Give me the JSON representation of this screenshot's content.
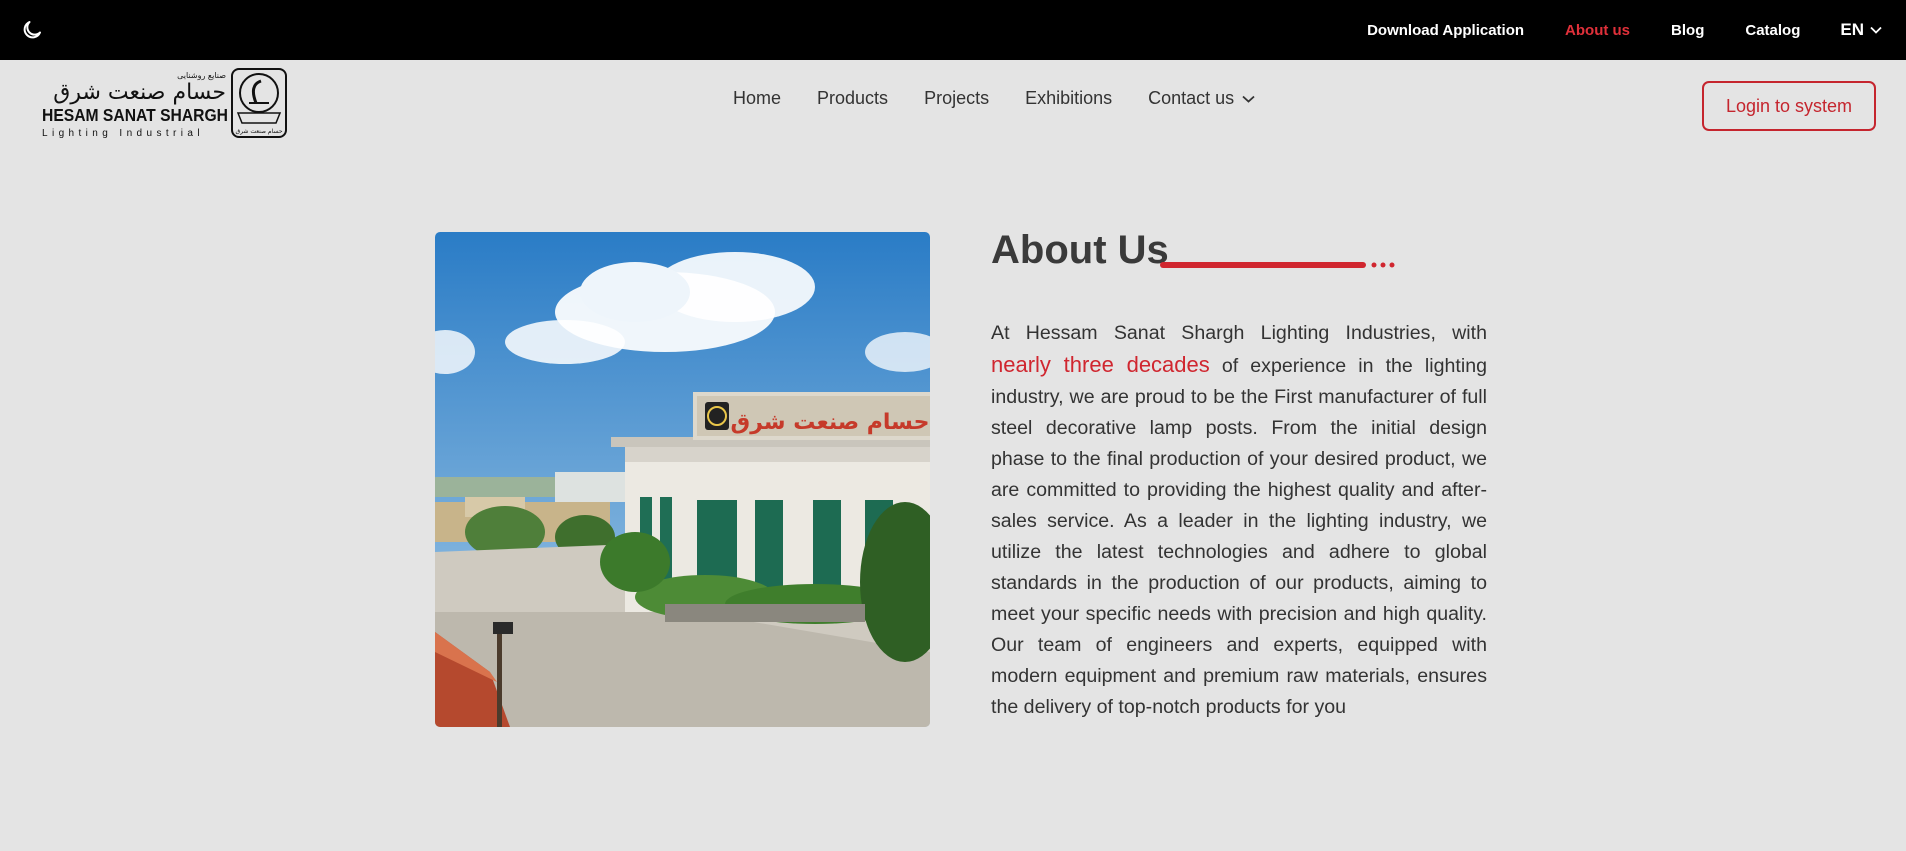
{
  "topbar": {
    "theme_icon": "moon-icon",
    "links": [
      "Download Application",
      "About us",
      "Blog",
      "Catalog"
    ],
    "active_link": "About us",
    "language": "EN"
  },
  "logo": {
    "persian_small": "صنایع روشنایی",
    "persian_name": "حسام صنعت شرق",
    "english_name": "HESAM SANAT SHARGH",
    "tagline": "Lighting Industrial",
    "emblem_text": "حسام صنعت شرق"
  },
  "nav": {
    "items": [
      "Home",
      "Products",
      "Projects",
      "Exhibitions"
    ],
    "contact": "Contact us"
  },
  "login_button": "Login to system",
  "photo": {
    "sign_text": "حسام صنعت شرق"
  },
  "about": {
    "title": "About Us",
    "intro": "At Hessam Sanat Shargh Lighting Industries, with",
    "highlight": "nearly three decades",
    "body": " of experience in the lighting industry, we are proud to be the First manufacturer of full steel decorative lamp posts. From the initial design phase to the final production of your desired product, we are committed to providing the highest quality and after-sales service. As a leader in the lighting industry, we utilize the latest technologies and adhere to global standards in the production of our products, aiming to meet your specific needs with precision and high quality. Our team of engineers and experts, equipped with modern equipment and premium raw materials, ensures the delivery of top-notch products for you"
  },
  "colors": {
    "accent": "#d0262f",
    "topbar": "#000000",
    "background": "#e4e4e4"
  }
}
